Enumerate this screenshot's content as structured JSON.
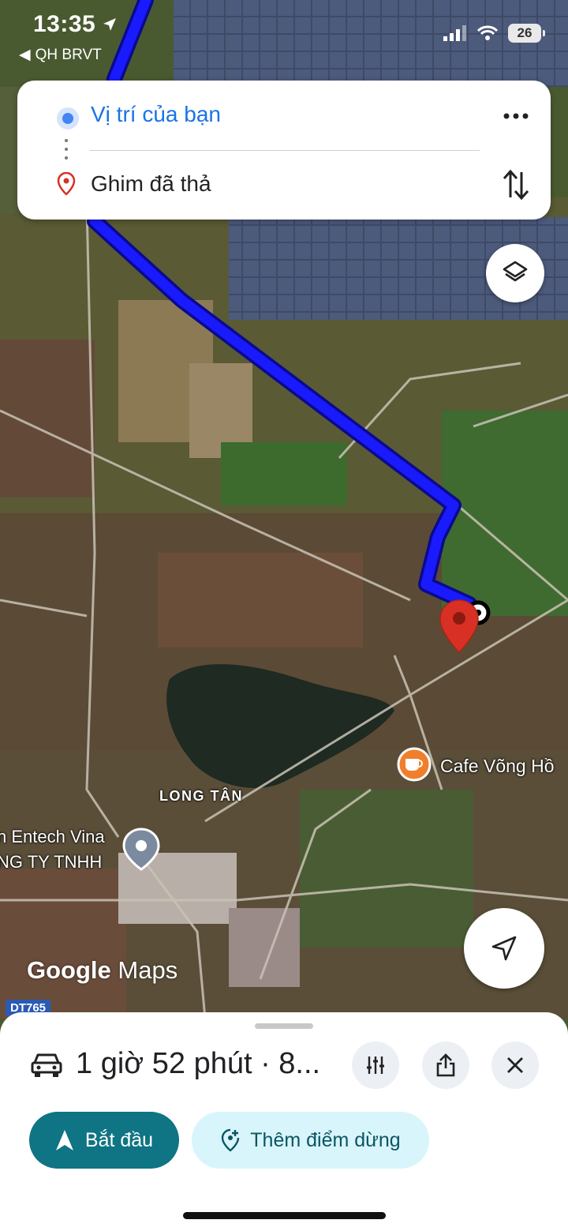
{
  "status_bar": {
    "time": "13:35",
    "back_app": "QH BRVT",
    "battery": "26"
  },
  "directions": {
    "from": "Vị trí của bạn",
    "to": "Ghim đã thả",
    "more_icon": "more-horizontal-icon",
    "swap_icon": "swap-vertical-icon"
  },
  "map": {
    "labels": {
      "area": "LONG TÂN",
      "cafe": "Cafe Võng Hồ",
      "business_line1": "n Entech Vina",
      "business_line2": "NG TY TNHH",
      "road_tag": "DT765"
    },
    "brand_google": "Google",
    "brand_maps": "Maps",
    "route_color": "#1a1aff",
    "pin_color": "#d93025"
  },
  "sheet": {
    "summary": "1 giờ 52 phút · 8...",
    "start_label": "Bắt đầu",
    "add_stop_label": "Thêm điểm dừng",
    "accent": "#0f7484"
  }
}
